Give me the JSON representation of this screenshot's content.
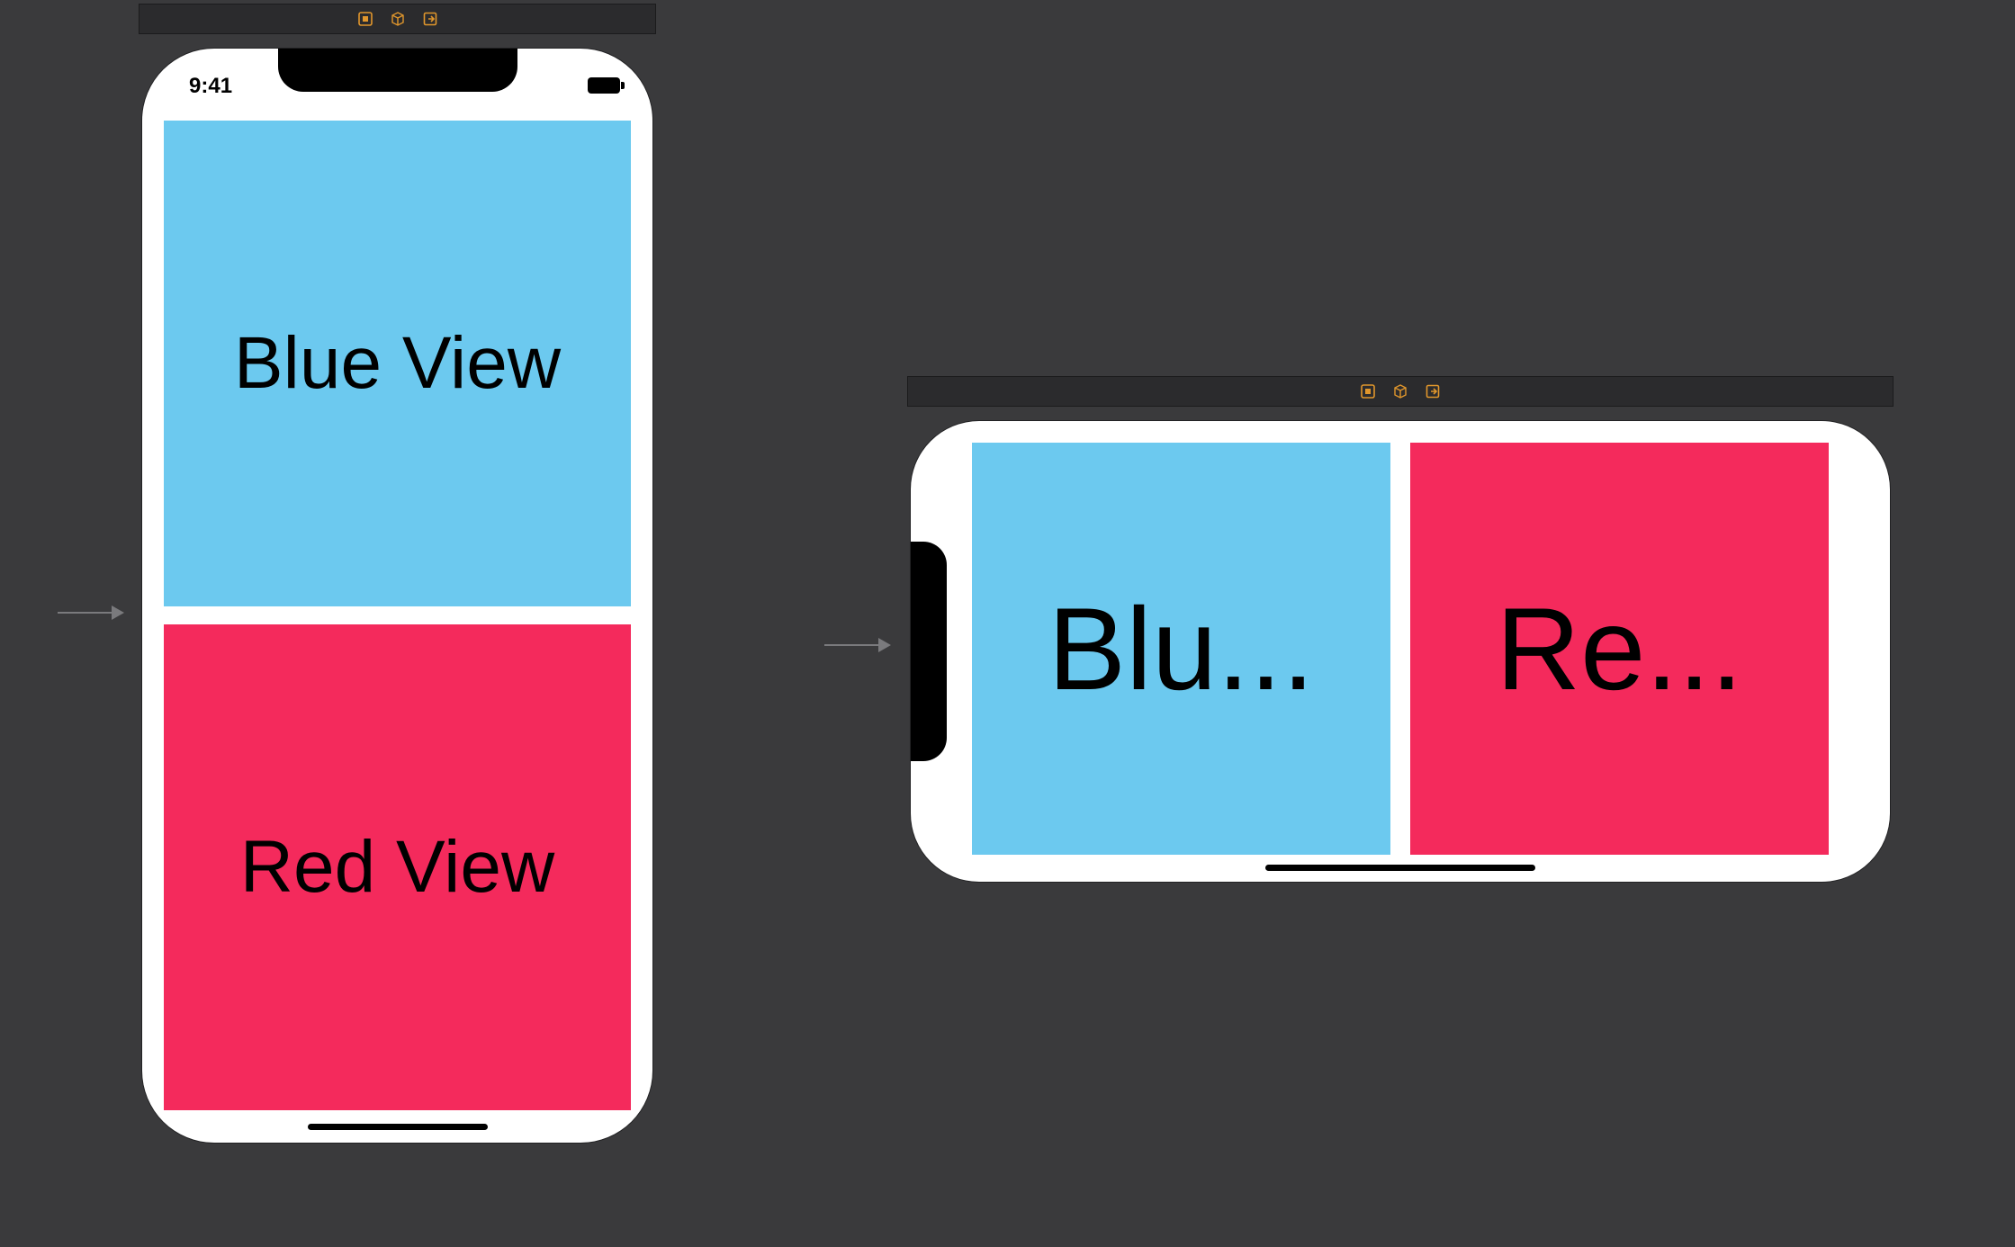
{
  "colors": {
    "canvas_bg": "#3a3a3c",
    "toolbar_bg": "#2b2b2d",
    "ib_accent": "#e0962c",
    "device_bg": "#ffffff",
    "blue_view": "#6cc9ef",
    "red_view": "#f42a5c",
    "arrow": "#7a7a7d"
  },
  "status_bar": {
    "time": "9:41"
  },
  "portrait": {
    "blue_label": "Blue View",
    "red_label": "Red View"
  },
  "landscape": {
    "blue_label": "Blu...",
    "red_label": "Re..."
  },
  "icons": {
    "stop": "stop-square-icon",
    "object": "cube-icon",
    "exit": "exit-icon"
  }
}
